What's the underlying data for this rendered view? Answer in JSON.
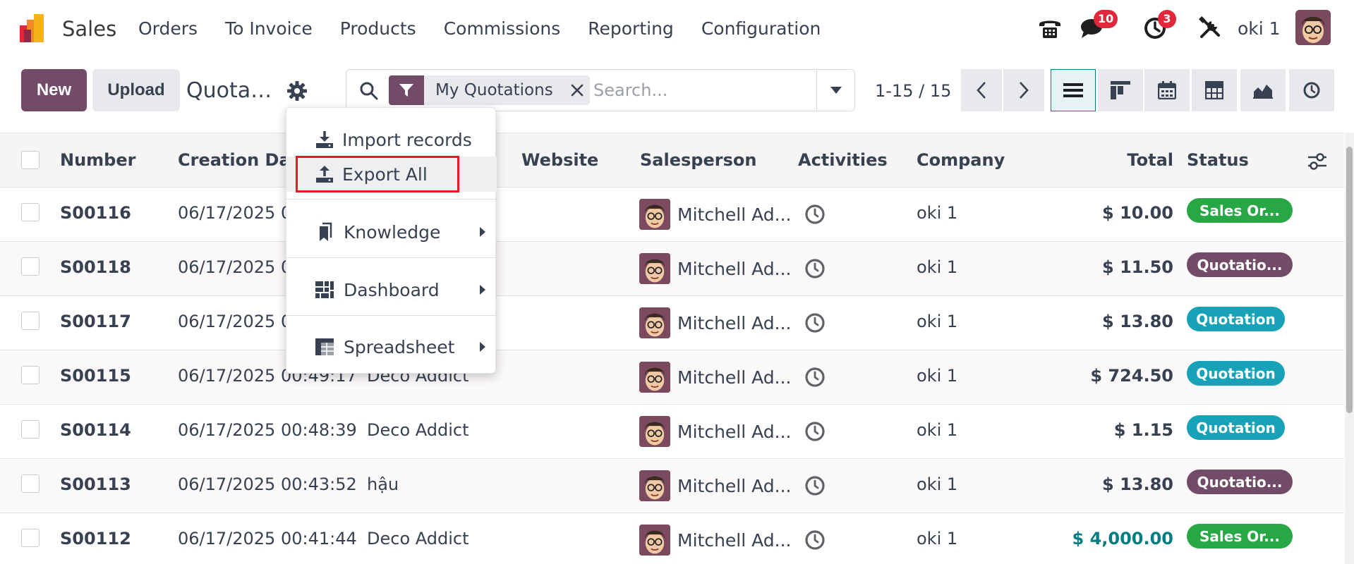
{
  "app": {
    "name": "Sales"
  },
  "nav": {
    "items": [
      {
        "label": "Orders"
      },
      {
        "label": "To Invoice"
      },
      {
        "label": "Products"
      },
      {
        "label": "Commissions"
      },
      {
        "label": "Reporting"
      },
      {
        "label": "Configuration"
      }
    ]
  },
  "systray": {
    "messages_count": "10",
    "activities_count": "3",
    "user_name": "oki 1",
    "icons": [
      "phone-icon",
      "chat-icon",
      "clock-icon",
      "tools-icon"
    ]
  },
  "control_panel": {
    "new_label": "New",
    "upload_label": "Upload",
    "title": "Quotati...",
    "search": {
      "facet_label": "My Quotations",
      "placeholder": "Search..."
    },
    "pager": "1-15 / 15",
    "views": [
      "list",
      "kanban",
      "calendar",
      "pivot",
      "graph",
      "activity"
    ]
  },
  "dropdown": {
    "items": [
      {
        "label": "Import records",
        "icon": "import-icon"
      },
      {
        "label": "Export All",
        "icon": "export-icon"
      },
      {
        "label": "Knowledge",
        "icon": "bookmark-icon"
      },
      {
        "label": "Dashboard",
        "icon": "dashboard-icon"
      },
      {
        "label": "Spreadsheet",
        "icon": "spreadsheet-icon"
      }
    ]
  },
  "table": {
    "headers": {
      "number": "Number",
      "creation_date": "Creation Date",
      "website": "Website",
      "salesperson": "Salesperson",
      "activities": "Activities",
      "company": "Company",
      "total": "Total",
      "status": "Status"
    },
    "rows": [
      {
        "number": "S00116",
        "date": "06/17/2025 0",
        "customer": "..",
        "salesperson": "Mitchell Ad...",
        "company": "oki 1",
        "total": "$ 10.00",
        "status": "Sales Or...",
        "status_color": "#28a745"
      },
      {
        "number": "S00118",
        "date": "06/17/2025 0",
        "customer": "",
        "salesperson": "Mitchell Ad...",
        "company": "oki 1",
        "total": "$ 11.50",
        "status": "Quotatio...",
        "status_color": "#714b67"
      },
      {
        "number": "S00117",
        "date": "06/17/2025 0",
        "customer": "",
        "salesperson": "Mitchell Ad...",
        "company": "oki 1",
        "total": "$ 13.80",
        "status": "Quotation",
        "status_color": "#17a2b8"
      },
      {
        "number": "S00115",
        "date": "06/17/2025 00:49:17",
        "customer": "Deco Addict",
        "salesperson": "Mitchell Ad...",
        "company": "oki 1",
        "total": "$ 724.50",
        "status": "Quotation",
        "status_color": "#17a2b8"
      },
      {
        "number": "S00114",
        "date": "06/17/2025 00:48:39",
        "customer": "Deco Addict",
        "salesperson": "Mitchell Ad...",
        "company": "oki 1",
        "total": "$ 1.15",
        "status": "Quotation",
        "status_color": "#17a2b8"
      },
      {
        "number": "S00113",
        "date": "06/17/2025 00:43:52",
        "customer": "hậu",
        "salesperson": "Mitchell Ad...",
        "company": "oki 1",
        "total": "$ 13.80",
        "status": "Quotatio...",
        "status_color": "#714b67"
      },
      {
        "number": "S00112",
        "date": "06/17/2025 00:41:44",
        "customer": "Deco Addict",
        "salesperson": "Mitchell Ad...",
        "company": "oki 1",
        "total": "$ 4,000.00",
        "status": "Sales Or...",
        "status_color": "#28a745"
      }
    ]
  },
  "colors": {
    "brand": "#714b67",
    "accent": "#017e84",
    "badge": "#e0283a",
    "highlight": "#e31b23"
  }
}
